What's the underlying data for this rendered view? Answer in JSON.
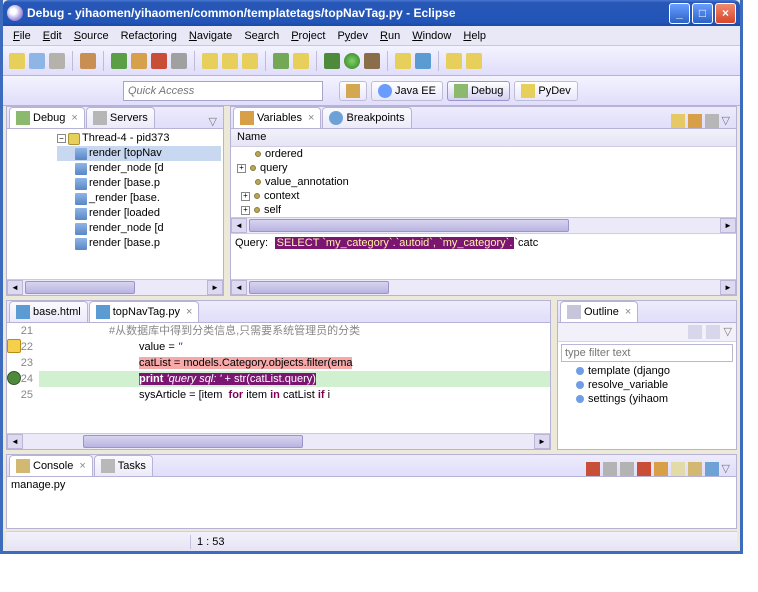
{
  "title": "Debug - yihaomen/yihaomen/common/templatetags/topNavTag.py - Eclipse",
  "menus": [
    "File",
    "Edit",
    "Source",
    "Refactoring",
    "Navigate",
    "Search",
    "Project",
    "Pydev",
    "Run",
    "Window",
    "Help"
  ],
  "quick_access_placeholder": "Quick Access",
  "perspectives": {
    "java_ee": "Java EE",
    "debug": "Debug",
    "pydev": "PyDev"
  },
  "debug_view": {
    "tabs": {
      "debug": "Debug",
      "servers": "Servers"
    },
    "thread": "Thread-4 - pid373",
    "frames": [
      "render [topNav",
      "render_node [d",
      "render [base.p",
      "_render [base.",
      "render [loaded",
      "render_node [d",
      "render [base.p"
    ]
  },
  "vars_view": {
    "tabs": {
      "variables": "Variables",
      "breakpoints": "Breakpoints"
    },
    "col_name": "Name",
    "items": [
      "ordered",
      "query",
      "value_annotation",
      "context",
      "self"
    ],
    "query_label": "Query:",
    "query_sql": "SELECT `my_category`.`autoid`, `my_category`.",
    "query_tail": "`catc"
  },
  "editor": {
    "tabs": {
      "base": "base.html",
      "topnav": "topNavTag.py"
    },
    "lines": {
      "l21": "#从数据库中得到分类信息,只需要系统管理员的分类",
      "l22": "value = ''",
      "l23": "catList = models.Category.objects.filter(ema",
      "l24_a": "print ",
      "l24_b": "'query sql: '",
      "l24_c": " + str(catList.query)",
      "l25": "sysArticle = [item  for item in catList if i"
    },
    "gutter": [
      "21",
      "22",
      "23",
      "24",
      "25"
    ]
  },
  "outline": {
    "title": "Outline",
    "filter_placeholder": "type filter text",
    "items": [
      "template (django",
      "resolve_variable",
      "settings (yihaom"
    ]
  },
  "console": {
    "tabs": {
      "console": "Console",
      "tasks": "Tasks"
    },
    "text": "manage.py"
  },
  "statusbar": {
    "pos": "1 : 53"
  }
}
